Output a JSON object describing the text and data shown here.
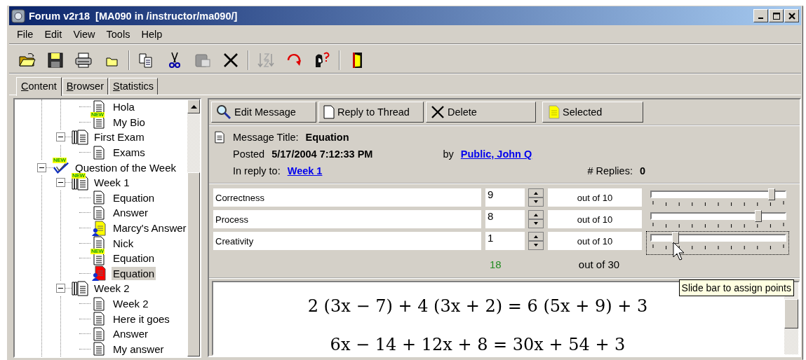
{
  "window": {
    "title": "Forum v2r18  [MA090 in /instructor/ma090/]"
  },
  "menu": [
    "File",
    "Edit",
    "View",
    "Tools",
    "Help"
  ],
  "tabs": [
    {
      "label": "Content",
      "selected": true
    },
    {
      "label": "Browser",
      "selected": false
    },
    {
      "label": "Statistics",
      "selected": false
    }
  ],
  "tree": {
    "items": [
      {
        "children": [
          {
            "children": [
              {
                "label": "Hola",
                "kind": "page",
                "selected": false
              },
              {
                "label": "My Bio",
                "kind": "page",
                "badge": "NEW",
                "selected": false
              }
            ]
          },
          {
            "label": "First Exam",
            "kind": "pages",
            "expanded": true,
            "selected": false,
            "children": [
              {
                "label": "Exams",
                "kind": "page",
                "selected": false
              }
            ]
          }
        ]
      },
      {
        "label": "Question of the Week",
        "kind": "quiz",
        "badge": "NEW",
        "expanded": true,
        "selected": false,
        "children": [
          {
            "label": "Week 1",
            "kind": "pages",
            "badge": "NEW",
            "expanded": true,
            "selected": false,
            "children": [
              {
                "label": "Equation",
                "kind": "page",
                "selected": false
              },
              {
                "label": "Answer",
                "kind": "page",
                "selected": false
              },
              {
                "label": "Marcy's Answer",
                "kind": "user-page",
                "color": "#ffff00",
                "selected": false
              },
              {
                "label": "Nick",
                "kind": "page",
                "selected": false
              },
              {
                "label": "Equation",
                "kind": "page",
                "badge": "NEW",
                "selected": false
              },
              {
                "label": "Equation",
                "kind": "user-page",
                "color": "#ff0000",
                "selected": true
              }
            ]
          },
          {
            "label": "Week 2",
            "kind": "pages",
            "expanded": true,
            "selected": false,
            "children": [
              {
                "label": "Week 2",
                "kind": "page",
                "selected": false
              },
              {
                "label": "Here it goes",
                "kind": "page",
                "selected": false
              },
              {
                "label": "Answer",
                "kind": "page",
                "selected": false
              },
              {
                "label": "My answer",
                "kind": "page",
                "selected": false
              }
            ]
          }
        ]
      }
    ]
  },
  "actions": [
    {
      "label": "Edit Message",
      "kind": "edit"
    },
    {
      "label": "Reply to Thread",
      "kind": "reply"
    },
    {
      "label": "Delete",
      "kind": "delete"
    },
    {
      "label": "Selected",
      "kind": "selected"
    }
  ],
  "message": {
    "title_label": "Message Title:",
    "title": "Equation",
    "posted_label": "Posted",
    "posted": "5/17/2004 7:12:33 PM",
    "by_label": "by",
    "author": "Public, John Q",
    "reply_label": "In reply to:",
    "reply_to": "Week 1",
    "replies_label": "# Replies:",
    "replies": "0"
  },
  "scores": [
    {
      "name": "Correctness",
      "value": "9",
      "out_of": "out of 10",
      "level": 0.9,
      "focused": false
    },
    {
      "name": "Process",
      "value": "8",
      "out_of": "out of 10",
      "level": 0.8,
      "focused": false
    },
    {
      "name": "Creativity",
      "value": "1",
      "out_of": "out of 10",
      "level": 0.18,
      "focused": true
    }
  ],
  "total": {
    "value": "18",
    "out_of": "out of 30"
  },
  "content": {
    "lines": [
      "2 (3x − 7) + 4 (3x + 2) = 6 (5x + 9) + 3",
      "6x − 14 + 12x + 8 = 30x + 54 + 3"
    ]
  },
  "tooltip": "Slide bar to assign points"
}
